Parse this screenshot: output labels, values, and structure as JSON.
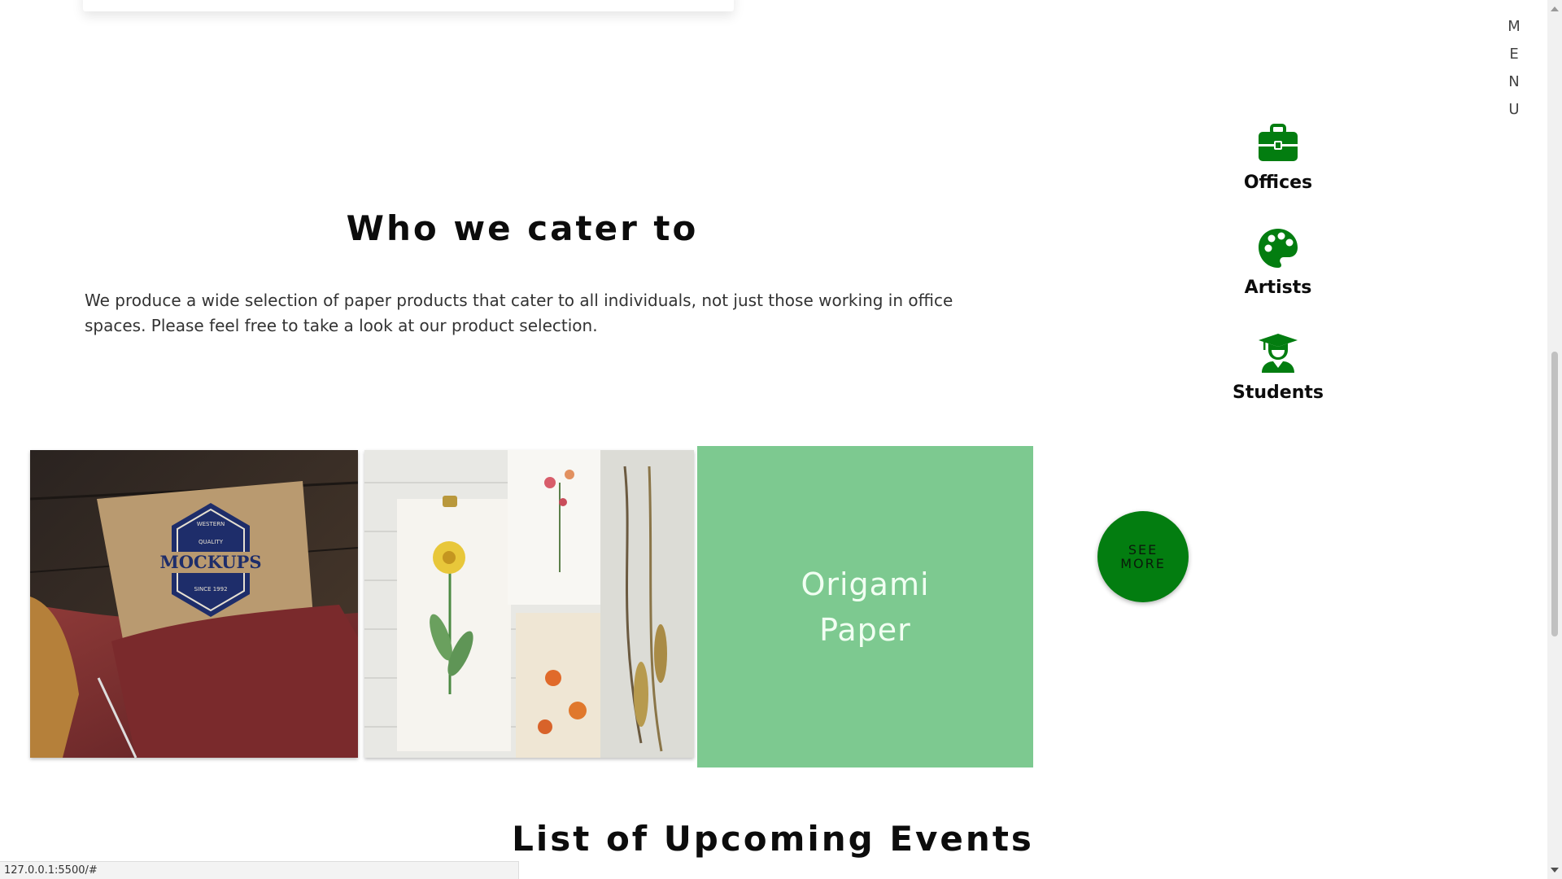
{
  "menu": {
    "letters": [
      "M",
      "E",
      "N",
      "U"
    ]
  },
  "about": {
    "title": "Who we cater to",
    "description": "We produce a wide selection of paper products that cater to all individuals, not just those working in office spaces. Please feel free to take a look at our product selection."
  },
  "categories": [
    {
      "label": "Offices",
      "icon": "briefcase-icon"
    },
    {
      "label": "Artists",
      "icon": "palette-icon"
    },
    {
      "label": "Students",
      "icon": "graduate-icon"
    }
  ],
  "gallery": {
    "wallet_card_text": {
      "top": "WESTERN",
      "sub": "QUALITY",
      "main": "MOCKUPS",
      "since": "SINCE 1992"
    },
    "feature_label": "Origami\nPaper",
    "see_more_label": "SEE\nMORE"
  },
  "events": {
    "title": "List of Upcoming Events"
  },
  "status_bar": {
    "url": "127.0.0.1:5500/#"
  },
  "colors": {
    "accent_green": "#037d10",
    "tile_green": "#7dc990",
    "tile_text": "#f1fff2"
  }
}
